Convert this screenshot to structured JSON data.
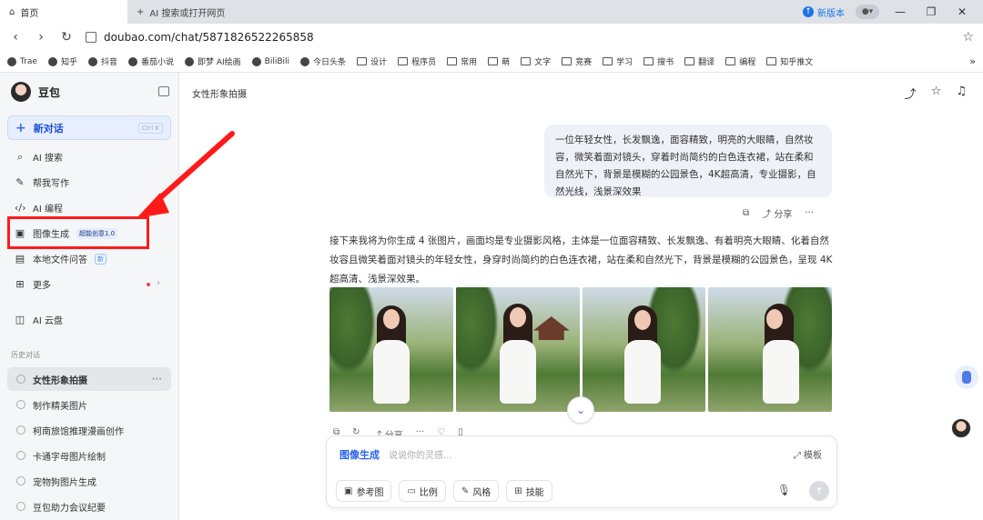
{
  "browser": {
    "tabs": [
      {
        "label": "首页",
        "active": true
      },
      {
        "label": "AI 搜索或打开网页",
        "active": false
      }
    ],
    "new_version": "新版本",
    "url": "doubao.com/chat/5871826522265858",
    "bookmarks": [
      "Trae",
      "知乎",
      "抖音",
      "番茄小说",
      "即梦 AI绘画",
      "BiliBili",
      "今日头条",
      "设计",
      "程序员",
      "常用",
      "萌",
      "文字",
      "竞赛",
      "学习",
      "搜书",
      "翻译",
      "编程",
      "知乎推文"
    ]
  },
  "sidebar": {
    "brand": "豆包",
    "new_chat": "新对话",
    "new_chat_shortcut": "Ctrl K",
    "items": [
      {
        "label": "AI 搜索",
        "icon": "search-icon"
      },
      {
        "label": "帮我写作",
        "icon": "pen-icon"
      },
      {
        "label": "AI 编程",
        "icon": "code-icon"
      },
      {
        "label": "图像生成",
        "icon": "image-icon",
        "badge": "超能创意1.0"
      },
      {
        "label": "本地文件问答",
        "icon": "file-icon",
        "badge": "新"
      },
      {
        "label": "更多",
        "icon": "grid-icon"
      },
      {
        "label": "AI 云盘",
        "icon": "cloud-drive-icon"
      }
    ],
    "history_title": "历史对话",
    "history": [
      {
        "label": "女性形象拍摄",
        "active": true
      },
      {
        "label": "制作精美图片",
        "active": false
      },
      {
        "label": "柯南旅馆推理漫画创作",
        "active": false
      },
      {
        "label": "卡通字母图片绘制",
        "active": false
      },
      {
        "label": "宠物狗图片生成",
        "active": false
      },
      {
        "label": "豆包助力会议纪要",
        "active": false
      }
    ]
  },
  "main": {
    "title": "女性形象拍摄",
    "user_message": "一位年轻女性，长发飘逸，面容精致，明亮的大眼睛，自然妆容，微笑着面对镜头，穿着时尚简约的白色连衣裙，站在柔和自然光下，背景是模糊的公园景色，4K超高清，专业摄影，自然光线，浅景深效果",
    "share_label": "分享",
    "reply": "接下来我将为你生成 4 张图片，画面均是专业摄影风格，主体是一位面容精致、长发飘逸、有着明亮大眼睛、化着自然妆容且微笑着面对镜头的年轻女性，身穿时尚简约的白色连衣裙，站在柔和自然光下，背景是模糊的公园景色，呈现 4K 超高清、浅景深效果。",
    "image_count": 4,
    "image_action_share": "分享"
  },
  "composer": {
    "mode": "图像生成",
    "placeholder": "说说你的灵感...",
    "template": "模板",
    "chips": [
      {
        "label": "参考图",
        "icon": "image-ref-icon"
      },
      {
        "label": "比例",
        "icon": "ratio-icon"
      },
      {
        "label": "风格",
        "icon": "brush-icon"
      },
      {
        "label": "技能",
        "icon": "skill-icon"
      }
    ]
  },
  "colors": {
    "accent": "#2563eb",
    "highlight": "#ff1a1a"
  }
}
